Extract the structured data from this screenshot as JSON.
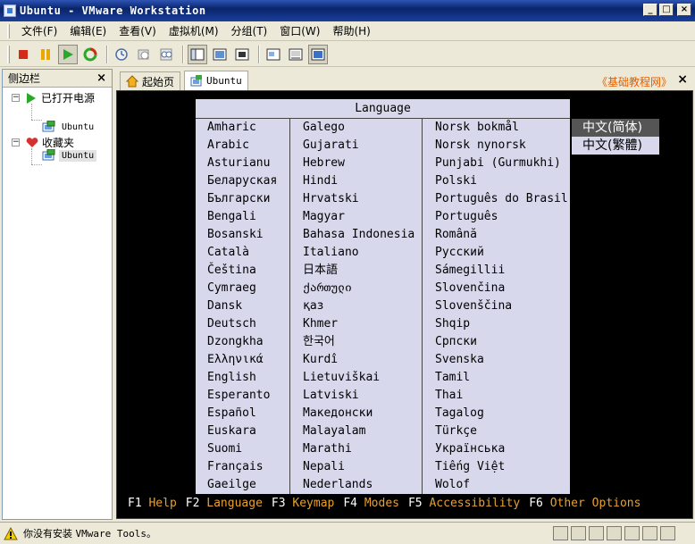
{
  "window": {
    "title": "Ubuntu - VMware Workstation",
    "minimize": "_",
    "maximize": "□",
    "close": "×"
  },
  "menu": [
    "文件(F)",
    "编辑(E)",
    "查看(V)",
    "虚拟机(M)",
    "分组(T)",
    "窗口(W)",
    "帮助(H)"
  ],
  "toolbar": {
    "icons": [
      "stop-icon",
      "pause-icon",
      "play-icon",
      "reset-icon",
      "snapshot-icon",
      "revert-icon",
      "manage-snapshots-icon",
      "sidebar-view-icon",
      "quick-switch-icon",
      "fullscreen-icon",
      "summary-icon",
      "console-icon",
      "appliance-view-icon"
    ]
  },
  "sidebar": {
    "title": "侧边栏",
    "close": "×",
    "groups": [
      {
        "label": "已打开电源",
        "expander": "−",
        "vm": "Ubuntu"
      },
      {
        "label": "收藏夹",
        "expander": "−",
        "vm": "Ubuntu"
      }
    ]
  },
  "tabs": [
    {
      "label": "起始页"
    },
    {
      "label": "Ubuntu"
    }
  ],
  "tab_link": "《基础教程网》",
  "tab_close": "×",
  "installer": {
    "title": "Language",
    "col1": [
      "Amharic",
      "Arabic",
      "Asturianu",
      "Беларуская",
      "Български",
      "Bengali",
      "Bosanski",
      "Català",
      "Čeština",
      "Cymraeg",
      "Dansk",
      "Deutsch",
      "Dzongkha",
      "Ελληνικά",
      "English",
      "Esperanto",
      "Español",
      "Euskara",
      "Suomi",
      "Français",
      "Gaeilge"
    ],
    "col2": [
      "Galego",
      "Gujarati",
      "Hebrew",
      "Hindi",
      "Hrvatski",
      "Magyar",
      "Bahasa Indonesia",
      "Italiano",
      "日本語",
      "ქართული",
      "қаз",
      "Khmer",
      "한국어",
      "Kurdî",
      "Lietuviškai",
      "Latviski",
      "Македонски",
      "Malayalam",
      "Marathi",
      "Nepali",
      "Nederlands"
    ],
    "col3": [
      "Norsk bokmål",
      "Norsk nynorsk",
      "Punjabi (Gurmukhi)",
      "Polski",
      "Português do Brasil",
      "Português",
      "Română",
      "Русский",
      "Sámegillii",
      "Slovenčina",
      "Slovenščina",
      "Shqip",
      "Српски",
      "Svenska",
      "Tamil",
      "Thai",
      "Tagalog",
      "Türkçe",
      "Українська",
      "Tiếng Việt",
      "Wolof"
    ],
    "cjk": [
      "中文(简体)",
      "中文(繁體)"
    ],
    "cjk_selected": 0,
    "fkeys": [
      {
        "key": "F1",
        "label": "Help"
      },
      {
        "key": "F2",
        "label": "Language"
      },
      {
        "key": "F3",
        "label": "Keymap"
      },
      {
        "key": "F4",
        "label": "Modes"
      },
      {
        "key": "F5",
        "label": "Accessibility"
      },
      {
        "key": "F6",
        "label": "Other Options"
      }
    ]
  },
  "status": {
    "message_prefix": "你没有安装 ",
    "message_mono": "VMware Tools",
    "message_suffix": "。"
  },
  "colors": {
    "console_bg": "#000000",
    "panel_bg": "#d8d8ec",
    "fkey_label": "#e8a030",
    "selected_bg": "#555555"
  }
}
